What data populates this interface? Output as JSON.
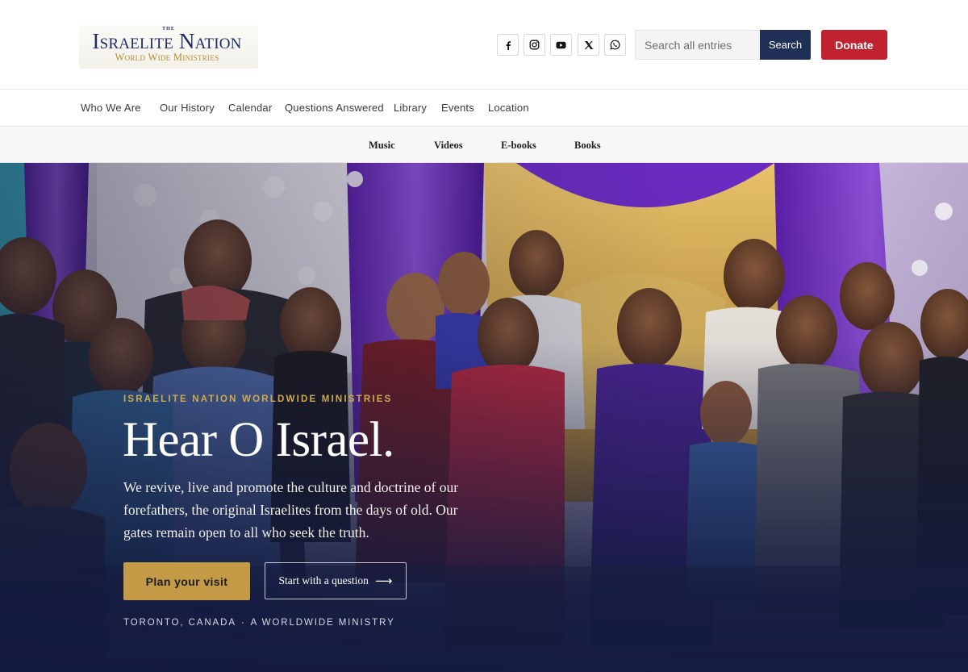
{
  "header": {
    "logo": {
      "the": "THE",
      "name": "Israelite Nation",
      "subtitle": "World Wide Ministries",
      "colors": {
        "primary": "#1f2d63",
        "gold": "#b08e2c"
      }
    },
    "social_icons": [
      "facebook-icon",
      "instagram-icon",
      "youtube-icon",
      "x-icon",
      "whatsapp-icon"
    ],
    "search": {
      "placeholder": "Search all entries",
      "value": "",
      "button_label": "Search"
    },
    "donate_label": "Donate",
    "colors": {
      "search_button": "#1f2f55",
      "donate": "#c1222f"
    }
  },
  "primary_nav": {
    "items": [
      "Who We Are",
      "Our History",
      "Calendar",
      "Questions Answered",
      "Library",
      "Events",
      "Location"
    ]
  },
  "secondary_nav": {
    "items": [
      "Music",
      "Videos",
      "E-books",
      "Books"
    ]
  },
  "hero": {
    "eyebrow": "ISRAELITE NATION WORLDWIDE MINISTRIES",
    "title": "Hear O Israel.",
    "description": "We revive, live and promote the culture and doctrine of our forefathers, the original Israelites from the days of old. Our gates remain open to all who seek the truth.",
    "primary_cta": "Plan your visit",
    "secondary_cta": "Start with a question",
    "location": "TORONTO, CANADA",
    "separator": "·",
    "tagline": "A WORLDWIDE MINISTRY",
    "colors": {
      "gold": "#c39a45",
      "eyebrow": "#cfa950",
      "overlay": "#121a3e"
    }
  }
}
